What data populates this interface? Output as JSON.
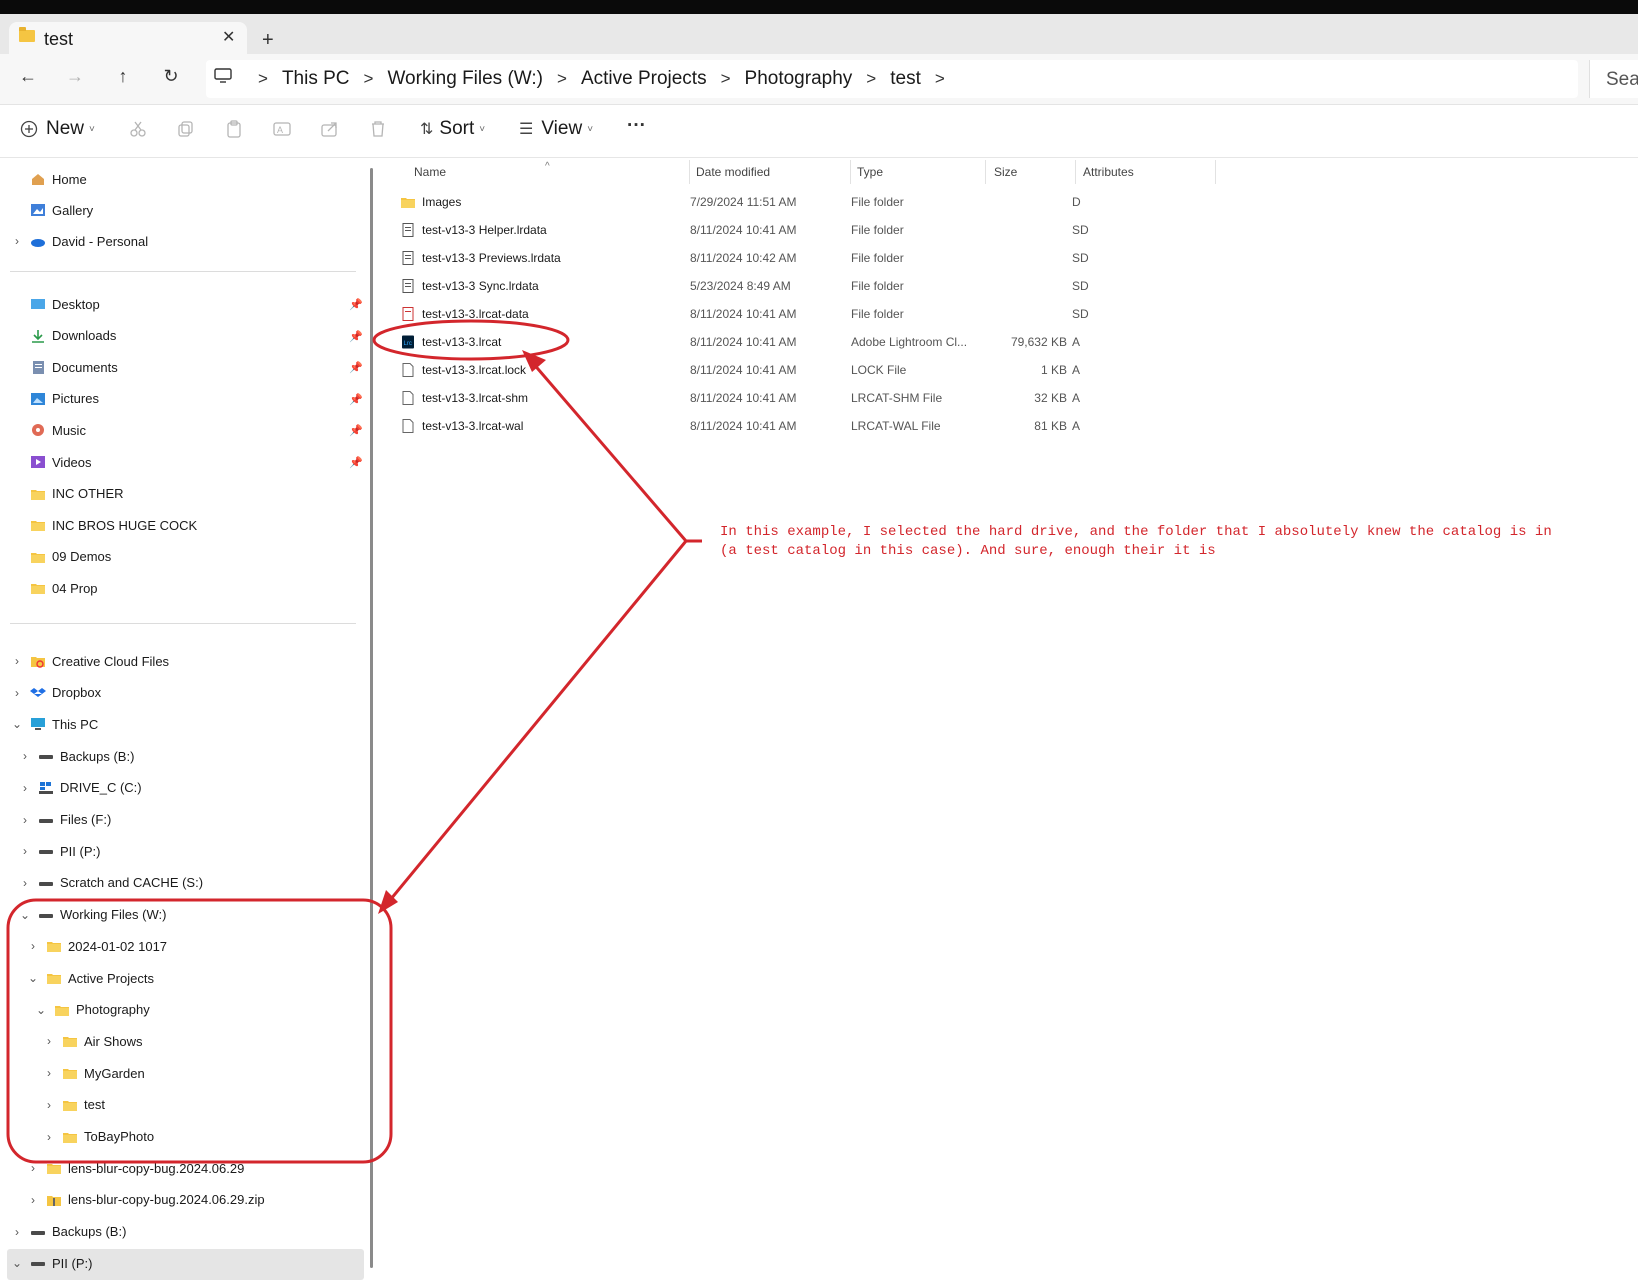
{
  "tab": {
    "title": "test",
    "close": "✕",
    "new": "+"
  },
  "nav": {
    "back": "←",
    "forward": "→",
    "up": "↑",
    "refresh": "↻"
  },
  "breadcrumbs": [
    "This PC",
    "Working Files (W:)",
    "Active Projects",
    "Photography",
    "test"
  ],
  "search": {
    "placeholder": "Sear"
  },
  "toolbar": {
    "new_label": "New",
    "sort_label": "Sort",
    "view_label": "View",
    "more_label": "···"
  },
  "sidebar": {
    "quick": [
      {
        "label": "Home",
        "icon": "home-icon"
      },
      {
        "label": "Gallery",
        "icon": "gallery-icon"
      },
      {
        "label": "David - Personal",
        "icon": "onedrive-icon"
      }
    ],
    "pinned": [
      {
        "label": "Desktop",
        "icon": "desktop-icon"
      },
      {
        "label": "Downloads",
        "icon": "download-icon"
      },
      {
        "label": "Documents",
        "icon": "documents-icon"
      },
      {
        "label": "Pictures",
        "icon": "pictures-icon"
      },
      {
        "label": "Music",
        "icon": "music-icon"
      },
      {
        "label": "Videos",
        "icon": "videos-icon"
      },
      {
        "label": "INC OTHER",
        "icon": "folder-icon"
      },
      {
        "label": "INC BROS HUGE COCK",
        "icon": "folder-icon"
      },
      {
        "label": "09 Demos",
        "icon": "folder-icon"
      },
      {
        "label": "04 Prop",
        "icon": "folder-icon"
      }
    ],
    "tree": [
      {
        "label": "Creative Cloud Files",
        "icon": "creative-cloud-icon"
      },
      {
        "label": "Dropbox",
        "icon": "dropbox-icon"
      },
      {
        "label": "This PC",
        "icon": "pc-icon"
      },
      {
        "label": "Backups (B:)",
        "icon": "drive-icon"
      },
      {
        "label": "DRIVE_C (C:)",
        "icon": "windows-drive-icon"
      },
      {
        "label": "Files (F:)",
        "icon": "drive-icon"
      },
      {
        "label": "PII (P:)",
        "icon": "drive-icon"
      },
      {
        "label": "Scratch and CACHE (S:)",
        "icon": "drive-icon"
      },
      {
        "label": "Working Files (W:)",
        "icon": "drive-icon"
      },
      {
        "label": "2024-01-02 1017",
        "icon": "folder-icon"
      },
      {
        "label": "Active Projects",
        "icon": "folder-icon"
      },
      {
        "label": "Photography",
        "icon": "folder-icon"
      },
      {
        "label": "Air Shows",
        "icon": "folder-icon"
      },
      {
        "label": "MyGarden",
        "icon": "folder-icon"
      },
      {
        "label": "test",
        "icon": "folder-icon"
      },
      {
        "label": "ToBayPhoto",
        "icon": "folder-icon"
      },
      {
        "label": "lens-blur-copy-bug.2024.06.29",
        "icon": "folder-icon"
      },
      {
        "label": "lens-blur-copy-bug.2024.06.29.zip",
        "icon": "zip-folder-icon"
      },
      {
        "label": "Backups (B:)",
        "icon": "drive-icon"
      },
      {
        "label": "PII (P:)",
        "icon": "drive-icon"
      }
    ]
  },
  "columns": {
    "name": "Name",
    "date": "Date modified",
    "type": "Type",
    "size": "Size",
    "attributes": "Attributes"
  },
  "files": [
    {
      "name": "Images",
      "date": "7/29/2024 11:51 AM",
      "type": "File folder",
      "size": "",
      "attr": "D",
      "icon": "folder-icon"
    },
    {
      "name": "test-v13-3 Helper.lrdata",
      "date": "8/11/2024 10:41 AM",
      "type": "File folder",
      "size": "",
      "attr": "SD",
      "icon": "lrdata-icon"
    },
    {
      "name": "test-v13-3 Previews.lrdata",
      "date": "8/11/2024 10:42 AM",
      "type": "File folder",
      "size": "",
      "attr": "SD",
      "icon": "lrdata-icon"
    },
    {
      "name": "test-v13-3 Sync.lrdata",
      "date": "5/23/2024 8:49 AM",
      "type": "File folder",
      "size": "",
      "attr": "SD",
      "icon": "lrdata-icon"
    },
    {
      "name": "test-v13-3.lrcat-data",
      "date": "8/11/2024 10:41 AM",
      "type": "File folder",
      "size": "",
      "attr": "SD",
      "icon": "lrcat-data-icon"
    },
    {
      "name": "test-v13-3.lrcat",
      "date": "8/11/2024 10:41 AM",
      "type": "Adobe Lightroom Cl...",
      "size": "79,632 KB",
      "attr": "A",
      "icon": "lightroom-catalog-icon"
    },
    {
      "name": "test-v13-3.lrcat.lock",
      "date": "8/11/2024 10:41 AM",
      "type": "LOCK File",
      "size": "1 KB",
      "attr": "A",
      "icon": "file-icon"
    },
    {
      "name": "test-v13-3.lrcat-shm",
      "date": "8/11/2024 10:41 AM",
      "type": "LRCAT-SHM File",
      "size": "32 KB",
      "attr": "A",
      "icon": "file-icon"
    },
    {
      "name": "test-v13-3.lrcat-wal",
      "date": "8/11/2024 10:41 AM",
      "type": "LRCAT-WAL File",
      "size": "81 KB",
      "attr": "A",
      "icon": "file-icon"
    }
  ],
  "annotation": {
    "line1": "In this example, I selected the hard drive, and the folder that I absolutely knew the catalog is in",
    "line2": "(a test catalog in this case). And sure, enough their it is",
    "color": "#d3262c"
  }
}
